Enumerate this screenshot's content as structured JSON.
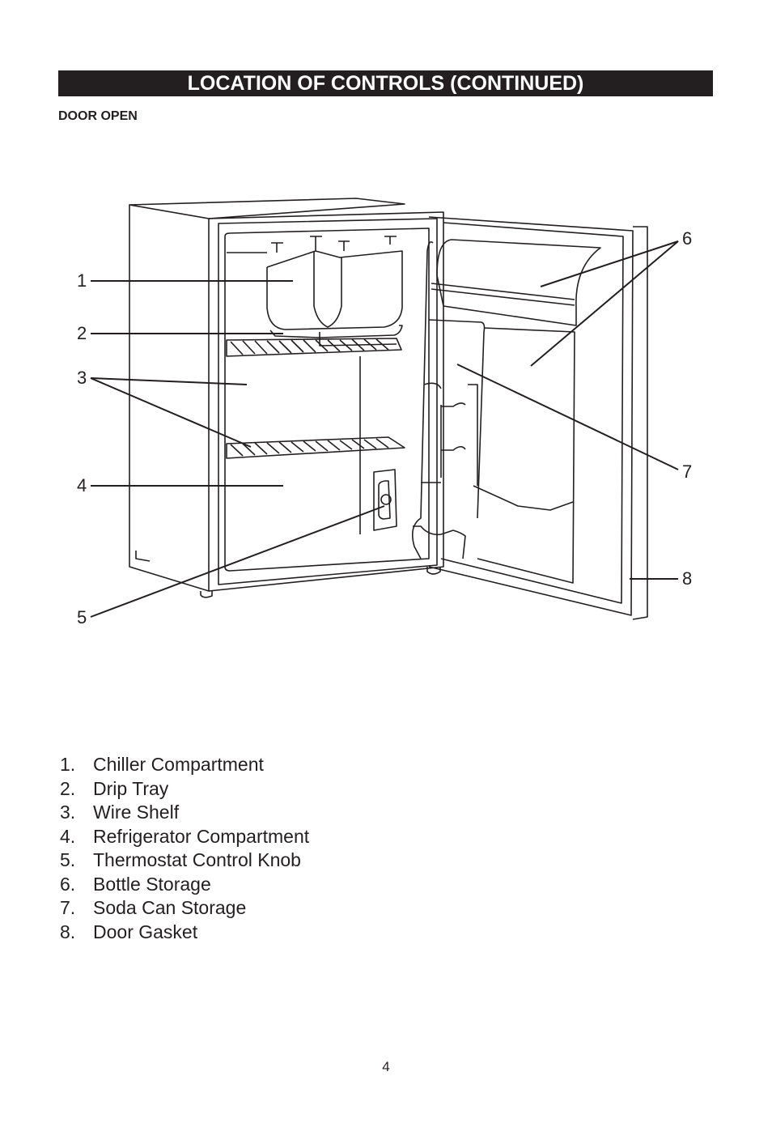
{
  "header": {
    "title": "LOCATION OF CONTROLS (CONTINUED)",
    "subtitle": "DOOR OPEN"
  },
  "callouts": [
    "1",
    "2",
    "3",
    "4",
    "5",
    "6",
    "7",
    "8"
  ],
  "legend": [
    {
      "num": "1.",
      "label": "Chiller Compartment"
    },
    {
      "num": "2.",
      "label": "Drip Tray"
    },
    {
      "num": "3.",
      "label": "Wire Shelf"
    },
    {
      "num": "4.",
      "label": "Refrigerator Compartment"
    },
    {
      "num": "5.",
      "label": "Thermostat Control Knob"
    },
    {
      "num": "6.",
      "label": "Bottle Storage"
    },
    {
      "num": "7.",
      "label": "Soda Can Storage"
    },
    {
      "num": "8.",
      "label": "Door Gasket"
    }
  ],
  "footer": {
    "page_number": "4"
  }
}
